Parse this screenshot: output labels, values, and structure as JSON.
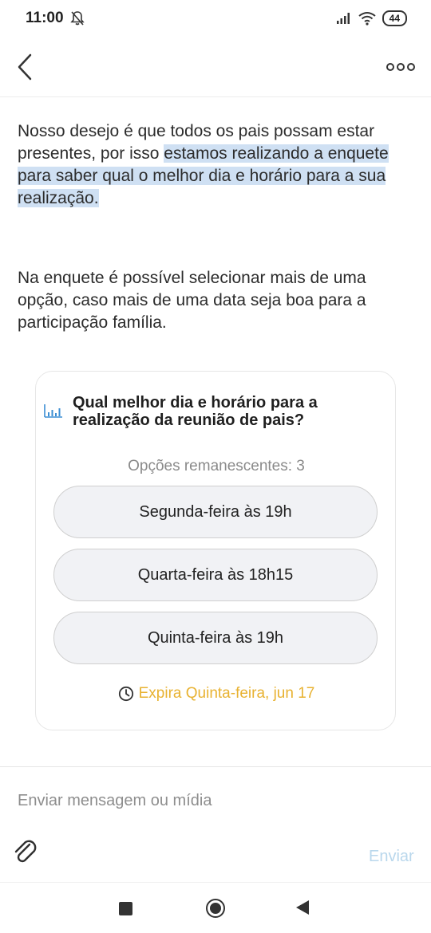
{
  "status_bar": {
    "time": "11:00",
    "battery": "44",
    "icons": [
      "bell-off-icon",
      "signal-icon",
      "wifi-icon",
      "battery-icon"
    ]
  },
  "app_bar": {
    "back_icon": "chevron-left-icon",
    "more_icon": "more-options-icon"
  },
  "messages": [
    {
      "parts": [
        "Nosso desejo é que todos os pais possam estar presentes, por isso ",
        "estamos realizando a enquete para saber qual o melhor dia e horário  para a sua realização."
      ]
    },
    {
      "text": "Na enquete é possível selecionar mais de uma opção, caso mais de uma data seja boa para a participação família."
    }
  ],
  "poll": {
    "icon": "poll-chart-icon",
    "question": "Qual melhor dia e horário para a realização da reunião de pais?",
    "remaining": "Opções remanescentes: 3",
    "options": [
      "Segunda-feira às 19h",
      "Quarta-feira às 18h15",
      "Quinta-feira às 19h"
    ],
    "expiry": "Expira Quinta-feira, jun 17",
    "expiry_icon": "clock-icon",
    "expiry_color": "#e8b231"
  },
  "composer": {
    "placeholder": "Enviar mensagem ou mídia",
    "attach_icon": "paperclip-icon",
    "send_label": "Enviar"
  },
  "nav_bar": {
    "icons": [
      "recent-apps-icon",
      "home-icon",
      "back-icon"
    ]
  },
  "colors": {
    "highlight": "#cfe0f3",
    "accent": "#e8b231",
    "send_disabled": "#b9d7ec"
  }
}
